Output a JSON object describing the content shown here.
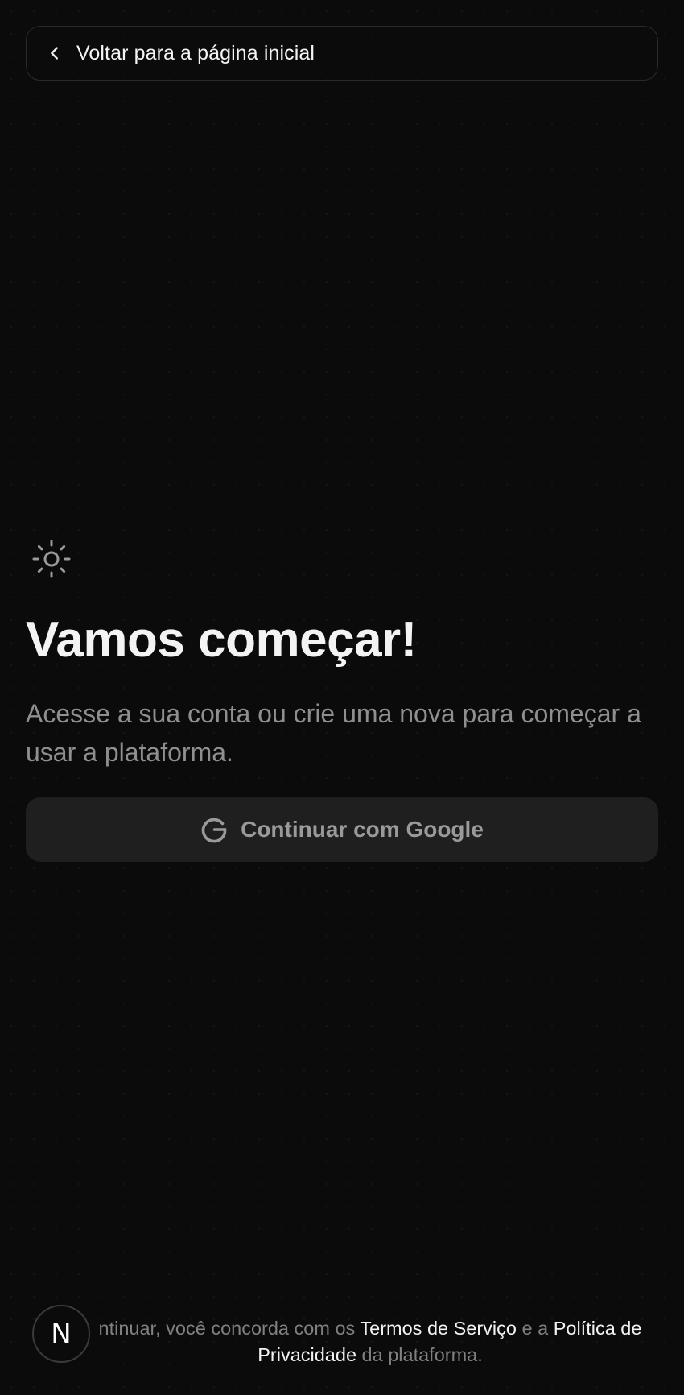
{
  "nav": {
    "back_label": "Voltar para a página inicial"
  },
  "main": {
    "title": "Vamos começar!",
    "subtitle": "Acesse a sua conta ou crie uma nova para começar a usar a plataforma.",
    "google_button_label": "Continuar com Google"
  },
  "footer": {
    "text_start": "ntinuar, você concorda com os ",
    "terms_link": "Termos de Serviço",
    "text_mid": " e a ",
    "privacy_link": "Política de Privacidade",
    "text_end": " da plataforma."
  },
  "badge": {
    "letter": "N"
  },
  "icons": {
    "back": "chevron-left-icon",
    "theme": "sun-icon",
    "google": "google-g-icon"
  },
  "colors": {
    "background": "#0b0b0b",
    "text_primary": "#f3f3f3",
    "text_muted": "#8f8f8f",
    "button_bg": "#1f1f1f"
  }
}
